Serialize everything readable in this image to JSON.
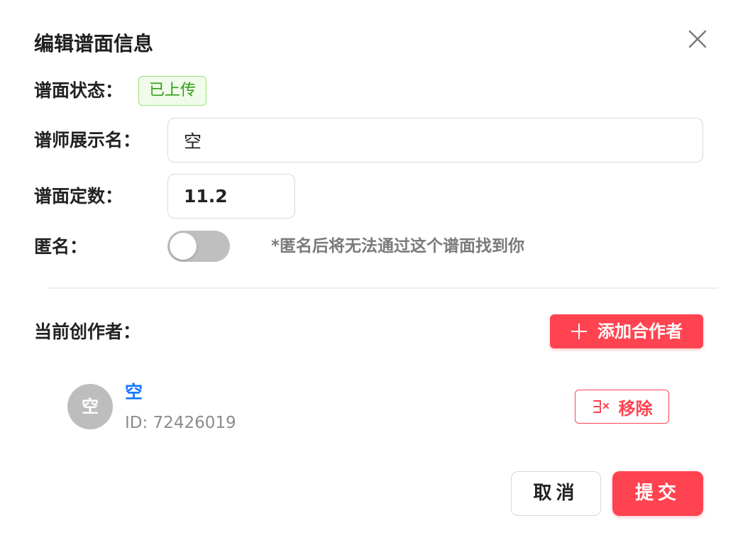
{
  "dialog": {
    "title": "编辑谱面信息",
    "close_icon": "close-icon"
  },
  "status": {
    "label": "谱面状态：",
    "badge": "已上传",
    "badge_color": "#2f9e18"
  },
  "display_name": {
    "label": "谱师展示名：",
    "value": "空"
  },
  "chart_level": {
    "label": "谱面定数：",
    "value": "11.2"
  },
  "anonymous": {
    "label": "匿名：",
    "enabled": false,
    "hint": "*匿名后将无法通过这个谱面找到你"
  },
  "authors": {
    "label": "当前创作者：",
    "add_button": "添加合作者",
    "add_icon": "plus-icon",
    "list": [
      {
        "avatar_text": "空",
        "name": "空",
        "id_text": "ID: 72426019",
        "remove_button": "移除",
        "remove_icon": "remove-user-icon"
      }
    ]
  },
  "actions": {
    "cancel": "取消",
    "submit": "提交"
  },
  "colors": {
    "accent": "#ff4350",
    "link": "#1677ff",
    "success": "#2f9e18"
  }
}
